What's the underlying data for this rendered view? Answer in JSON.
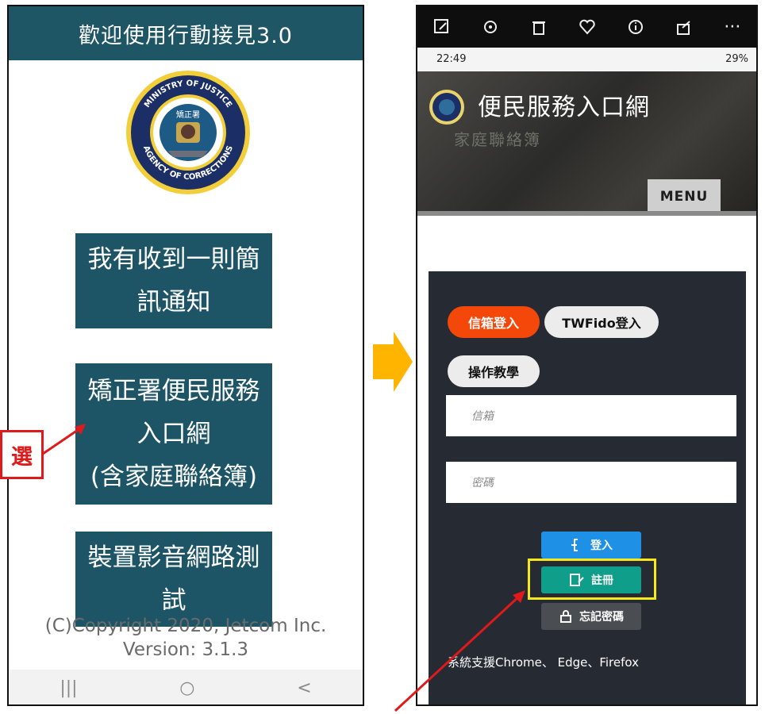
{
  "left": {
    "header_title": "歡迎使用行動接見3.0",
    "emblem_texts": [
      "MINISTRY OF JUSTICE",
      "AGENCY OF CORRECTIONS",
      "矯正署"
    ],
    "buttons": [
      {
        "line1": "我有收到一則簡",
        "line2": "訊通知",
        "line3": ""
      },
      {
        "line1": "矯正署便民服務",
        "line2": "入口網",
        "line3": "(含家庭聯絡簿)"
      },
      {
        "line1": "裝置影音網路測",
        "line2": "試",
        "line3": ""
      }
    ],
    "copyright": "(C)Copyright 2020, Jetcom Inc.",
    "version": "Version: 3.1.3",
    "navbar": {
      "recent": "|||",
      "home": "○",
      "back": "<"
    }
  },
  "annotation": {
    "label": "選",
    "color": "#e01a1a"
  },
  "right": {
    "toolbar_icons": [
      "edit-icon",
      "refresh-icon",
      "trash-icon",
      "heart-icon",
      "info-icon",
      "share-icon",
      "more-icon"
    ],
    "more_label": "···",
    "status_time": "22:49",
    "status_battery": "29%",
    "hero_title": "便民服務入口網",
    "hero_subtitle": "家庭聯絡簿",
    "menu_label": "MENU",
    "tabs": {
      "email_login": "信箱登入",
      "twfido_login": "TWFido登入",
      "tutorial": "操作教學"
    },
    "email_placeholder": "信箱",
    "password_placeholder": "密碼",
    "actions": {
      "login": "登入",
      "register": "註冊",
      "forgot": "忘記密碼"
    },
    "support_text": "系統支援Chrome、 Edge、Firefox"
  },
  "colors": {
    "accent_teal": "#1f5666",
    "email_pill": "#f4470a",
    "login_blue": "#1e90e6",
    "register_teal": "#0f9e8a",
    "highlight_yellow": "#f6e81a",
    "arrow_orange": "#ffb400"
  }
}
